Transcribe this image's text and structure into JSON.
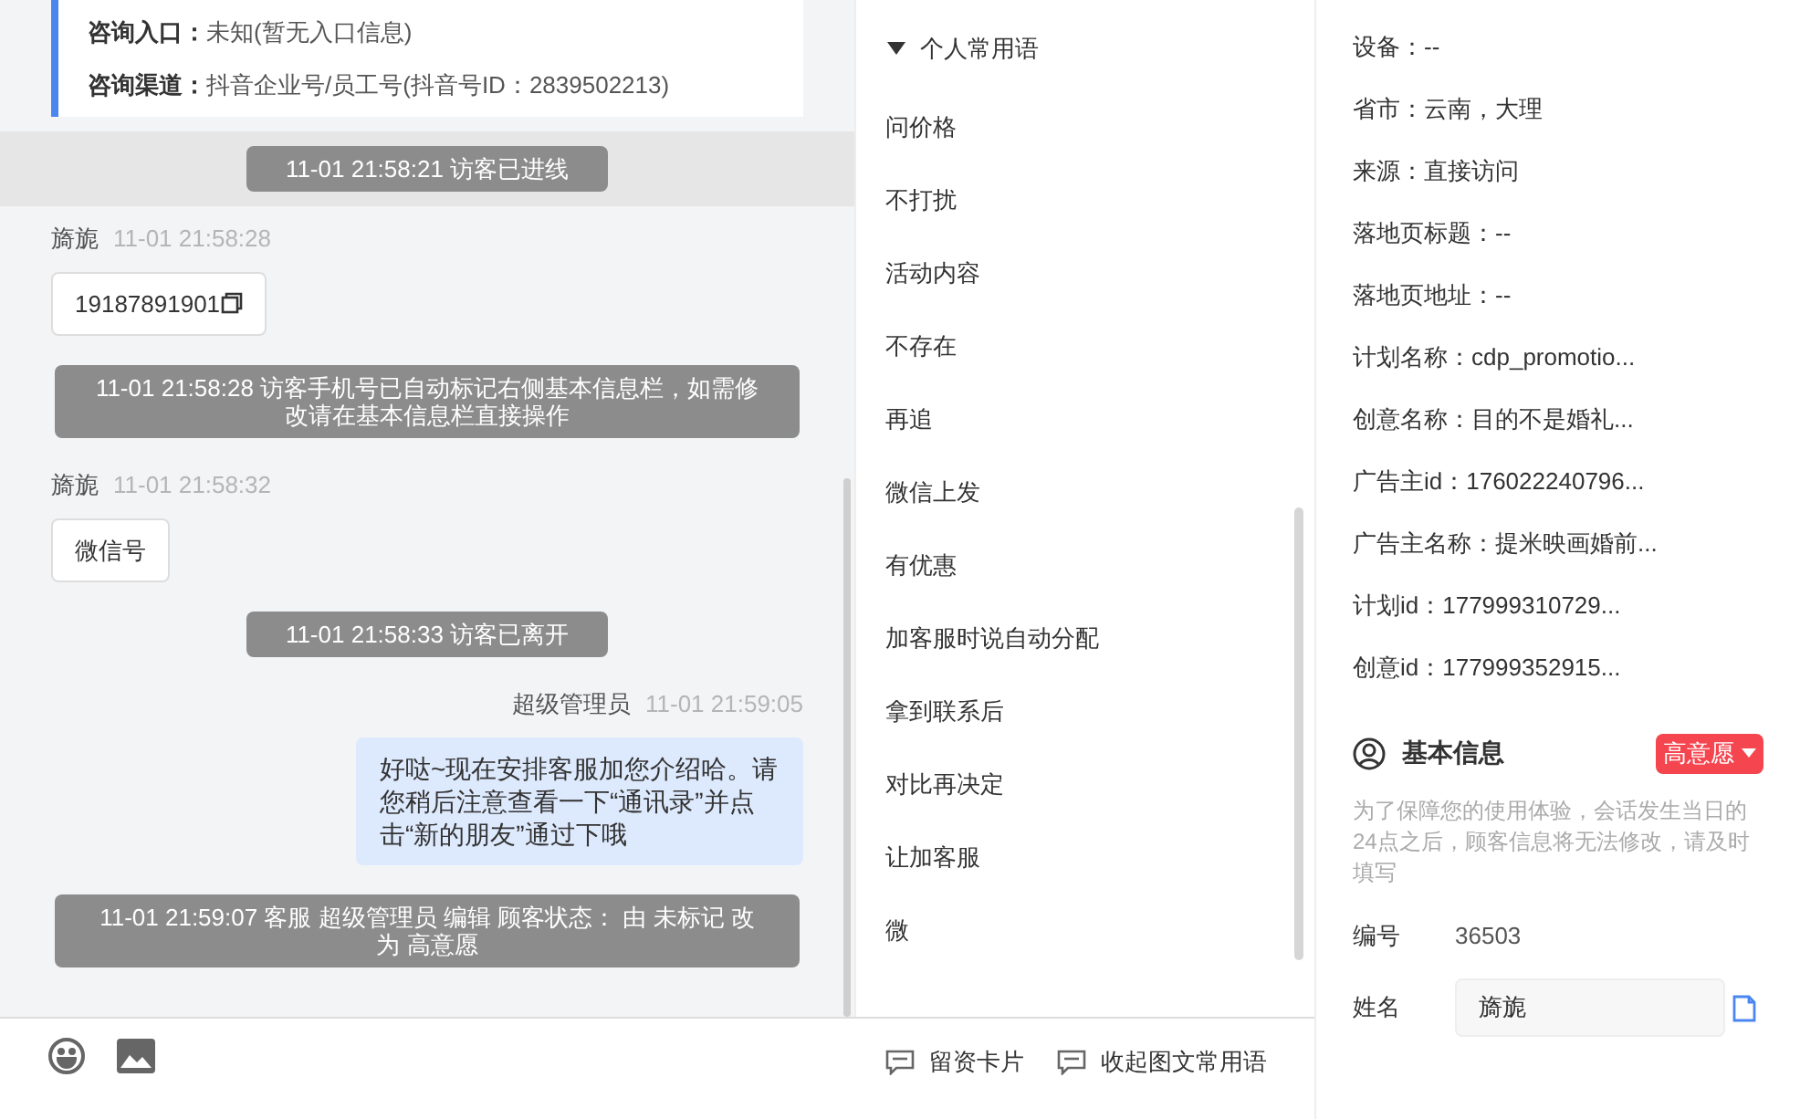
{
  "consult_card": {
    "fields": [
      {
        "label": "咨询入口：",
        "value": "未知(暂无入口信息)"
      },
      {
        "label": "咨询渠道：",
        "value": "抖音企业号/员工号(抖音号ID：2839502213)"
      }
    ]
  },
  "messages": [
    {
      "kind": "system",
      "text": "11-01 21:58:21 访客已进线",
      "highlighted": true
    },
    {
      "kind": "visitor",
      "sender": "旖旎",
      "time": "11-01 21:58:28",
      "text": "19187891901",
      "copyable": true
    },
    {
      "kind": "system",
      "text": "11-01 21:58:28 访客手机号已自动标记右侧基本信息栏，如需修改请在基本信息栏直接操作",
      "highlighted": false
    },
    {
      "kind": "visitor",
      "sender": "旖旎",
      "time": "11-01 21:58:32",
      "text": "微信号",
      "copyable": false
    },
    {
      "kind": "system",
      "text": "11-01 21:58:33 访客已离开",
      "highlighted": false
    },
    {
      "kind": "agent",
      "sender": "超级管理员",
      "time": "11-01 21:59:05",
      "text": "好哒~现在安排客服加您介绍哈。请您稍后注意查看一下“通讯录”并点击“新的朋友”通过下哦"
    },
    {
      "kind": "system",
      "text": "11-01 21:59:07 客服 超级管理员 编辑 顾客状态： 由 未标记 改为 高意愿",
      "highlighted": false
    }
  ],
  "input_toolbar": {
    "actions": [
      {
        "label": "留资卡片"
      },
      {
        "label": "收起图文常用语"
      }
    ]
  },
  "phrases": {
    "group": {
      "label": "个人常用语",
      "expanded": true
    },
    "items": [
      "问价格",
      "不打扰",
      "活动内容",
      "不存在",
      "再追",
      "微信上发",
      "有优惠",
      "加客服时说自动分配",
      "拿到联系后",
      "对比再决定",
      "让加客服",
      "微"
    ]
  },
  "visit_info": [
    "设备：--",
    "省市：云南，大理",
    "来源：直接访问",
    "落地页标题：--",
    "落地页地址：--",
    "计划名称：cdp_promotio...",
    "创意名称：目的不是婚礼...",
    "广告主id：176022240796...",
    "广告主名称：提米映画婚前...",
    "计划id：177999310729...",
    "创意id：177999352915..."
  ],
  "basic_info": {
    "title": "基本信息",
    "status": {
      "label": "高意愿",
      "color": "#f5454f"
    },
    "notice": "为了保障您的使用体验，会话发生当日的24点之后，顾客信息将无法修改，请及时填写",
    "fields": [
      {
        "kind": "text",
        "label": "编号",
        "value": "36503"
      },
      {
        "kind": "input",
        "label": "姓名",
        "value": "旖旎"
      }
    ]
  }
}
